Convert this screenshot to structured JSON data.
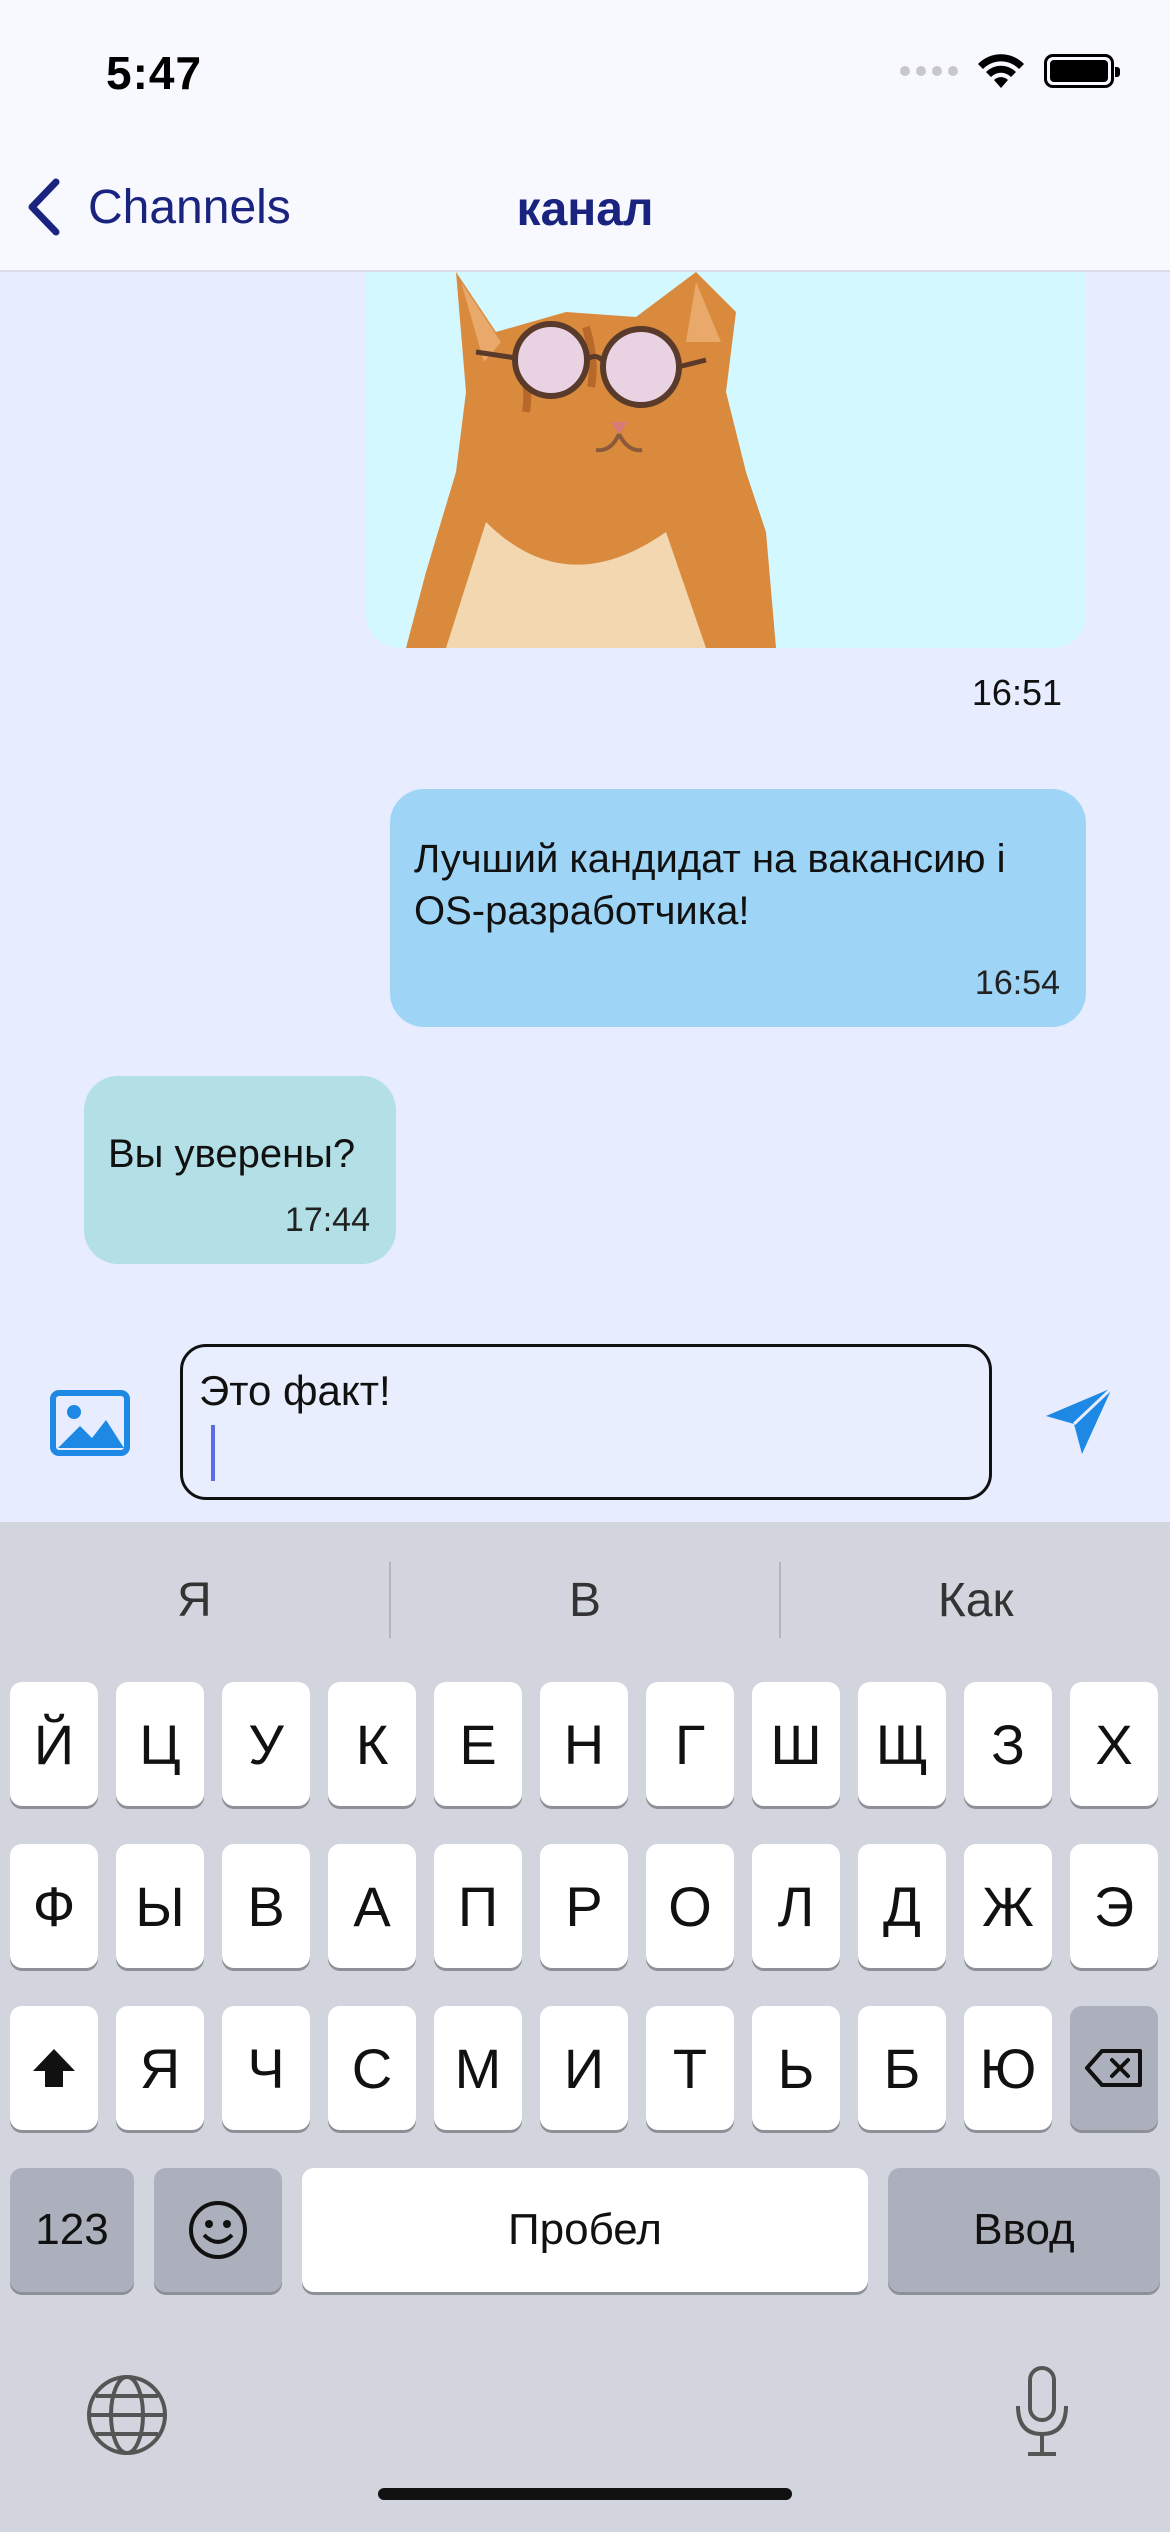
{
  "status_bar": {
    "time": "5:47"
  },
  "nav": {
    "back_label": "Channels",
    "title": "канал"
  },
  "messages": [
    {
      "type": "image",
      "description": "cat-with-sunglasses",
      "time": "16:51"
    },
    {
      "type": "text",
      "direction": "outgoing",
      "text": "Лучший кандидат на вакансию i OS-разработчика!",
      "time": "16:54"
    },
    {
      "type": "text",
      "direction": "incoming",
      "text": "Вы уверены?",
      "time": "17:44"
    }
  ],
  "composer": {
    "value": "Это факт!"
  },
  "keyboard": {
    "suggestions": [
      "Я",
      "В",
      "Как"
    ],
    "row1": [
      "Й",
      "Ц",
      "У",
      "К",
      "Е",
      "Н",
      "Г",
      "Ш",
      "Щ",
      "З",
      "Х"
    ],
    "row2": [
      "Ф",
      "Ы",
      "В",
      "А",
      "П",
      "Р",
      "О",
      "Л",
      "Д",
      "Ж",
      "Э"
    ],
    "row3": [
      "Я",
      "Ч",
      "С",
      "М",
      "И",
      "Т",
      "Ь",
      "Б",
      "Ю"
    ],
    "numbers_label": "123",
    "space_label": "Пробел",
    "return_label": "Ввод"
  },
  "colors": {
    "accent": "#1a237e",
    "send": "#1e88e5",
    "outgoing_bubble": "#9ed5f6",
    "incoming_bubble": "#b2e0e6"
  }
}
